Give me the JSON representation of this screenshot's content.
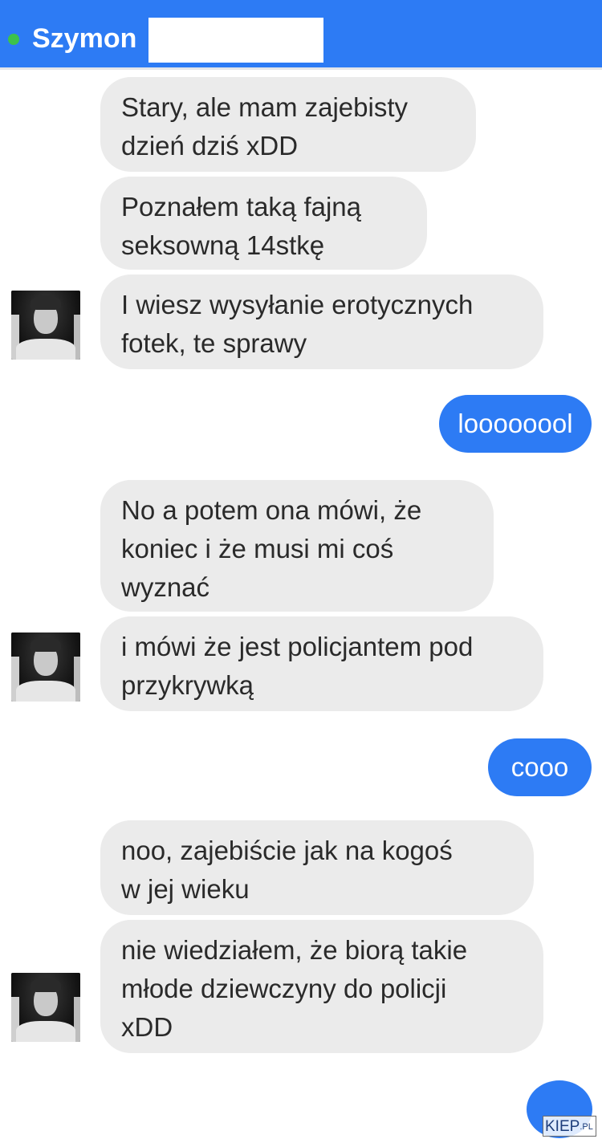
{
  "header": {
    "contact_name": "Szymon",
    "status_color": "#3dc24b",
    "bar_color": "#2d7bf4"
  },
  "messages": [
    {
      "from": "contact",
      "text": "Stary, ale mam zajebisty\ndzień dziś xDD"
    },
    {
      "from": "contact",
      "text": "Poznałem taką fajną\nseksowną 14stkę"
    },
    {
      "from": "contact",
      "text": "I wiesz wysyłanie erotycznych\nfotek, te sprawy"
    },
    {
      "from": "me",
      "text": "loooooool"
    },
    {
      "from": "contact",
      "text": "No a potem ona mówi, że\nkoniec i że musi mi coś\nwyznać"
    },
    {
      "from": "contact",
      "text": "i mówi że jest policjantem pod\nprzykrywką"
    },
    {
      "from": "me",
      "text": "cooo"
    },
    {
      "from": "contact",
      "text": "noo, zajebiście jak na kogoś\nw jej wieku"
    },
    {
      "from": "contact",
      "text": "nie wiedziałem, że biorą takie\nmłode dziewczyny do policji\nxDD"
    },
    {
      "from": "me",
      "text": ""
    }
  ],
  "watermark": {
    "main": "KIEP",
    "suffix": ".PL"
  }
}
